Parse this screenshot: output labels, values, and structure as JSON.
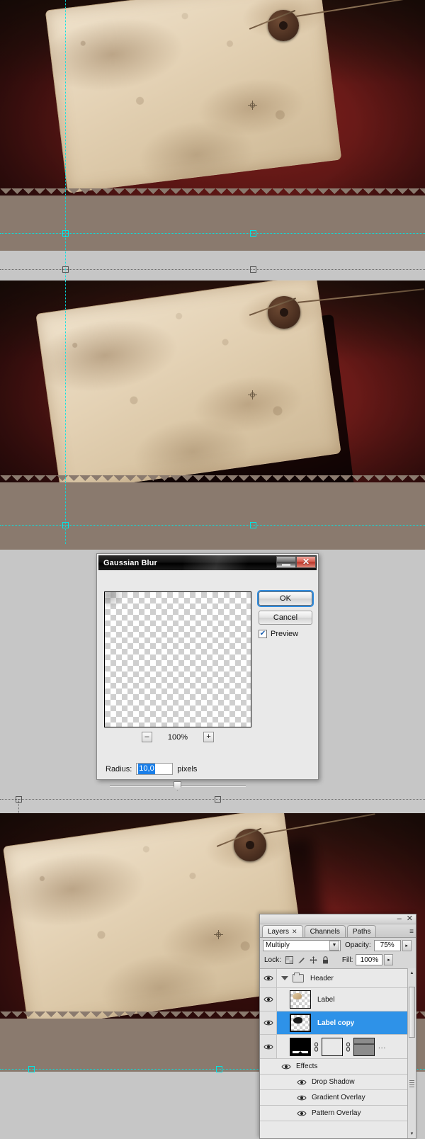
{
  "app": "Adobe Photoshop",
  "panels": {
    "photo_top": {
      "name": "document-canvas-top"
    },
    "photo_mid": {
      "name": "document-canvas-middle"
    },
    "photo_bottom": {
      "name": "document-canvas-bottom"
    }
  },
  "dialog": {
    "title": "Gaussian Blur",
    "buttons": {
      "ok": "OK",
      "cancel": "Cancel"
    },
    "preview_checkbox": {
      "label": "Preview",
      "checked": true,
      "glyph": "✔"
    },
    "zoom": {
      "minus": "–",
      "percent": "100%",
      "plus": "+"
    },
    "radius": {
      "label": "Radius:",
      "value": "10,0",
      "unit": "pixels"
    },
    "window_buttons": {
      "minimize": "",
      "close": "✕"
    }
  },
  "layers_panel": {
    "window_buttons": {
      "minimize": "–",
      "close": "✕"
    },
    "menu_glyph": "≡",
    "tabs": [
      {
        "label": "Layers",
        "close": "✕",
        "active": true
      },
      {
        "label": "Channels",
        "close": "",
        "active": false
      },
      {
        "label": "Paths",
        "close": "",
        "active": false
      }
    ],
    "blend_mode": {
      "value": "Multiply",
      "arrow": "▼"
    },
    "opacity": {
      "label": "Opacity:",
      "value": "75%",
      "arrow": "▸"
    },
    "lock": {
      "label": "Lock:",
      "icons": [
        "lock-transparent-pixels-icon",
        "lock-image-pixels-icon",
        "lock-position-icon",
        "lock-all-icon"
      ]
    },
    "fill": {
      "label": "Fill:",
      "value": "100%",
      "arrow": "▸"
    },
    "layers": [
      {
        "name": "Header",
        "type": "group",
        "visible": true,
        "expanded": true,
        "selected": false
      },
      {
        "name": "Label",
        "type": "layer",
        "visible": true,
        "selected": false
      },
      {
        "name": "Label copy",
        "type": "layer",
        "visible": true,
        "selected": true
      },
      {
        "name": "",
        "type": "smart-layer",
        "visible": true,
        "selected": false,
        "dots": "..."
      }
    ],
    "effects": {
      "label": "Effects",
      "items": [
        "Drop Shadow",
        "Gradient Overlay",
        "Pattern Overlay"
      ]
    },
    "scrollbar": {
      "up": "▲",
      "down": "▼"
    }
  },
  "colors": {
    "selection_blue": "#2e92e8",
    "guide_cyan": "#00e5e5",
    "dialog_bg": "#e9e9e9",
    "panel_bg": "#d7d7d7",
    "canvas_red": "#5e1715",
    "band_taupe": "#8a7a6e"
  }
}
